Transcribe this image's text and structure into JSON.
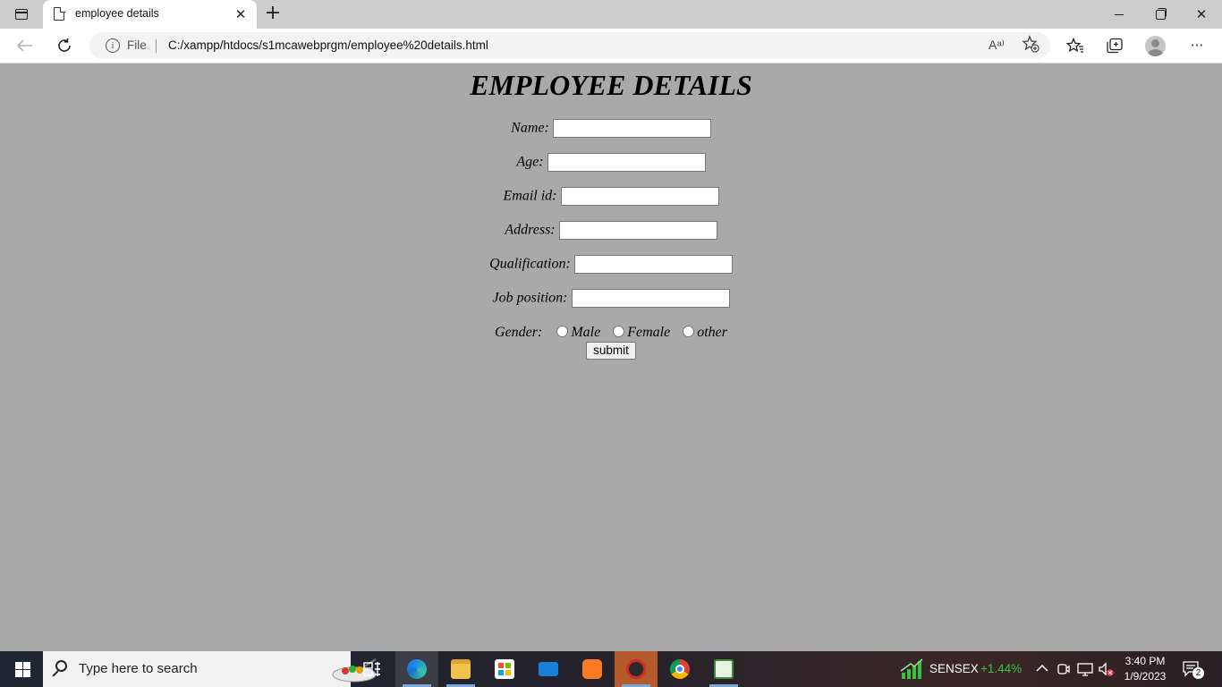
{
  "browser": {
    "tab_title": "employee details",
    "tab_close_glyph": "✕",
    "new_tab_glyph": "+",
    "scheme_label": "File",
    "info_glyph": "i",
    "url": "C:/xampp/htdocs/s1mcawebprgm/employee%20details.html",
    "read_aloud_glyph": "Aᵃ⁾",
    "window_close_glyph": "✕",
    "more_glyph": "···"
  },
  "page": {
    "heading": "EMPLOYEE DETAILS",
    "fields": [
      {
        "label": "Name:",
        "value": ""
      },
      {
        "label": "Age:",
        "value": ""
      },
      {
        "label": "Email id:",
        "value": ""
      },
      {
        "label": "Address:",
        "value": ""
      },
      {
        "label": "Qualification:",
        "value": ""
      },
      {
        "label": "Job position:",
        "value": ""
      }
    ],
    "gender_label": "Gender:",
    "gender_options": [
      "Male",
      "Female",
      "other"
    ],
    "submit_label": "submit"
  },
  "taskbar": {
    "search_placeholder": "Type here to search",
    "stock_name": "SENSEX",
    "stock_change": "+1.44%",
    "stock_change_color": "#3fbf3f",
    "time": "3:40 PM",
    "date": "1/9/2023",
    "notification_count": "2"
  }
}
